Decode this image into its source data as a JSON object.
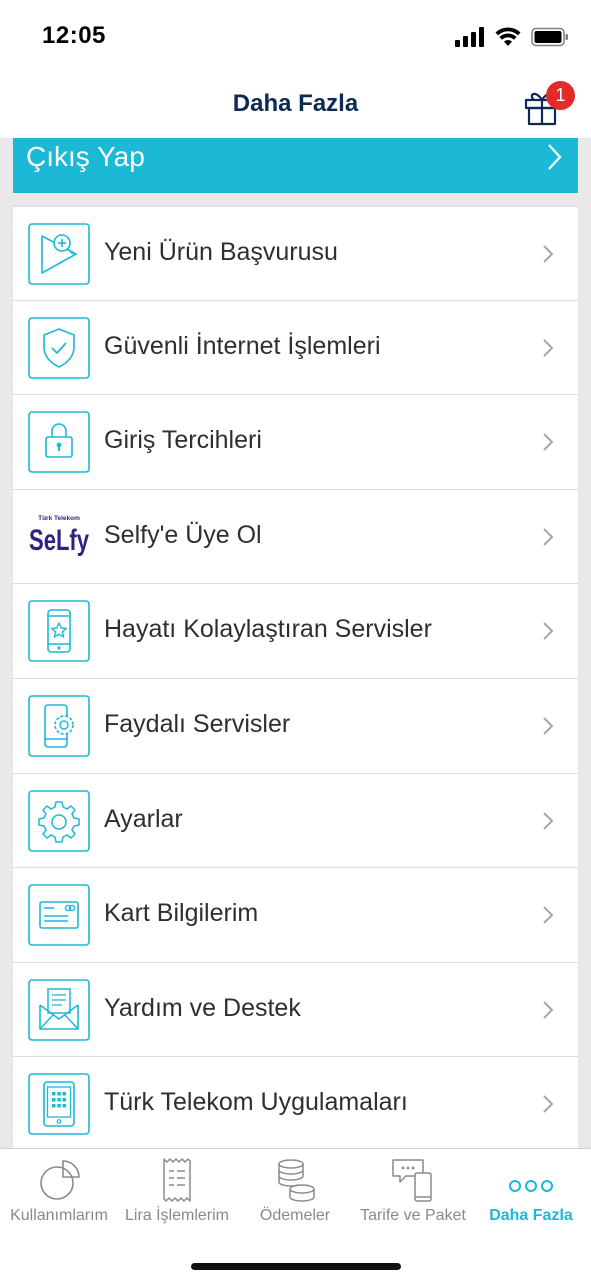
{
  "status": {
    "time": "12:05"
  },
  "header": {
    "title": "Daha Fazla",
    "gift_badge": "1"
  },
  "logout": {
    "label": "Çıkış Yap"
  },
  "menu": {
    "items": [
      {
        "label": "Yeni Ürün Başvurusu",
        "icon": "new-product-icon"
      },
      {
        "label": "Güvenli İnternet İşlemleri",
        "icon": "shield-check-icon"
      },
      {
        "label": "Giriş Tercihleri",
        "icon": "lock-icon"
      },
      {
        "label": "Selfy'e Üye Ol",
        "icon": "selfy-logo",
        "logo_small": "Türk Telekom",
        "logo_text": "SeLfy"
      },
      {
        "label": "Hayatı Kolaylaştıran Servisler",
        "icon": "phone-star-icon"
      },
      {
        "label": "Faydalı Servisler",
        "icon": "phone-gear-icon"
      },
      {
        "label": "Ayarlar",
        "icon": "gear-icon"
      },
      {
        "label": "Kart Bilgilerim",
        "icon": "credit-card-icon"
      },
      {
        "label": "Yardım ve Destek",
        "icon": "envelope-icon"
      },
      {
        "label": "Türk Telekom Uygulamaları",
        "icon": "tablet-apps-icon"
      }
    ]
  },
  "tabbar": {
    "tabs": [
      {
        "label": "Kullanımlarım",
        "icon": "pie-chart-icon"
      },
      {
        "label": "Lira İşlemlerim",
        "icon": "receipt-icon"
      },
      {
        "label": "Ödemeler",
        "icon": "coins-icon"
      },
      {
        "label": "Tarife ve Paket",
        "icon": "chat-phone-icon"
      },
      {
        "label": "Daha Fazla",
        "icon": "more-dots-icon",
        "active": true
      }
    ]
  },
  "colors": {
    "accent": "#1cb9d6",
    "title": "#0c2a56",
    "badge": "#e32b2b",
    "selfy": "#2b2580"
  }
}
